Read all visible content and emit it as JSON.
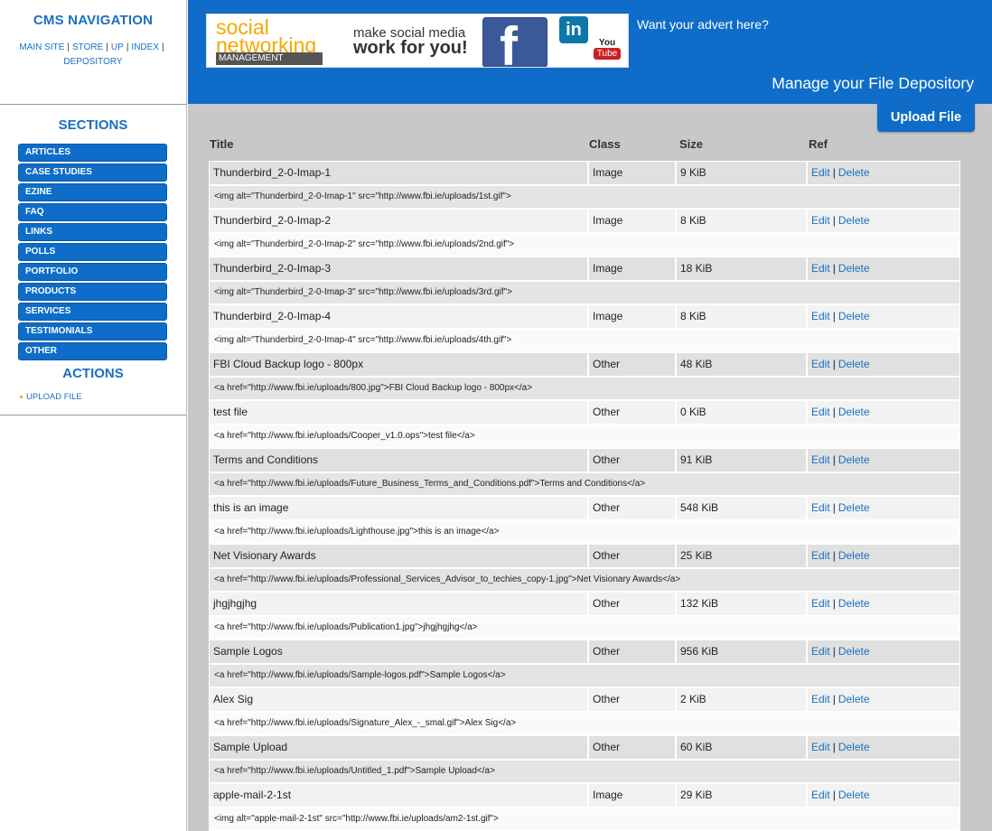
{
  "nav": {
    "title": "CMS NAVIGATION",
    "links": [
      "MAIN SITE",
      "STORE",
      "UP",
      "INDEX",
      "DEPOSITORY"
    ]
  },
  "sections": {
    "title": "SECTIONS",
    "items": [
      "ARTICLES",
      "CASE STUDIES",
      "EZINE",
      "FAQ",
      "LINKS",
      "POLLS",
      "PORTFOLIO",
      "PRODUCTS",
      "SERVICES",
      "TESTIMONIALS",
      "OTHER"
    ]
  },
  "actions": {
    "title": "ACTIONS",
    "items": [
      "UPLOAD FILE"
    ]
  },
  "banner": {
    "social": "social",
    "networking": "networking",
    "management": "MANAGEMENT",
    "make": "make social media",
    "work": "work for you!",
    "fb": "f",
    "li": "in",
    "yt_top": "You",
    "yt_bottom": "Tube"
  },
  "header": {
    "advert": "Want your advert here?",
    "page_title": "Manage your File Depository"
  },
  "upload_button": "Upload File",
  "table": {
    "headers": {
      "title": "Title",
      "class": "Class",
      "size": "Size",
      "ref": "Ref"
    },
    "edit": "Edit",
    "sep": "|",
    "delete": "Delete",
    "rows": [
      {
        "title": "Thunderbird_2-0-Imap-1",
        "class": "Image",
        "size": "9 KiB",
        "code": "<img alt=\"Thunderbird_2-0-Imap-1\" src=\"http://www.fbi.ie/uploads/1st.gif\">"
      },
      {
        "title": "Thunderbird_2-0-Imap-2",
        "class": "Image",
        "size": "8 KiB",
        "code": "<img alt=\"Thunderbird_2-0-Imap-2\" src=\"http://www.fbi.ie/uploads/2nd.gif\">"
      },
      {
        "title": "Thunderbird_2-0-Imap-3",
        "class": "Image",
        "size": "18 KiB",
        "code": "<img alt=\"Thunderbird_2-0-Imap-3\" src=\"http://www.fbi.ie/uploads/3rd.gif\">"
      },
      {
        "title": "Thunderbird_2-0-Imap-4",
        "class": "Image",
        "size": "8 KiB",
        "code": "<img alt=\"Thunderbird_2-0-Imap-4\" src=\"http://www.fbi.ie/uploads/4th.gif\">"
      },
      {
        "title": "FBI Cloud Backup logo - 800px",
        "class": "Other",
        "size": "48 KiB",
        "code": "<a href=\"http://www.fbi.ie/uploads/800.jpg\">FBI Cloud Backup logo - 800px</a>"
      },
      {
        "title": "test file",
        "class": "Other",
        "size": "0 KiB",
        "code": "<a href=\"http://www.fbi.ie/uploads/Cooper_v1.0.ops\">test file</a>"
      },
      {
        "title": "Terms and Conditions",
        "class": "Other",
        "size": "91 KiB",
        "code": "<a href=\"http://www.fbi.ie/uploads/Future_Business_Terms_and_Conditions.pdf\">Terms and Conditions</a>"
      },
      {
        "title": "this is an image",
        "class": "Other",
        "size": "548 KiB",
        "code": "<a href=\"http://www.fbi.ie/uploads/Lighthouse.jpg\">this is an image</a>"
      },
      {
        "title": "Net Visionary Awards",
        "class": "Other",
        "size": "25 KiB",
        "code": "<a href=\"http://www.fbi.ie/uploads/Professional_Services_Advisor_to_techies_copy-1.jpg\">Net Visionary Awards</a>"
      },
      {
        "title": "jhgjhgjhg",
        "class": "Other",
        "size": "132 KiB",
        "code": "<a href=\"http://www.fbi.ie/uploads/Publication1.jpg\">jhgjhgjhg</a>"
      },
      {
        "title": "Sample Logos",
        "class": "Other",
        "size": "956 KiB",
        "code": "<a href=\"http://www.fbi.ie/uploads/Sample-logos.pdf\">Sample Logos</a>"
      },
      {
        "title": "Alex Sig",
        "class": "Other",
        "size": "2 KiB",
        "code": "<a href=\"http://www.fbi.ie/uploads/Signature_Alex_-_smal.gif\">Alex Sig</a>"
      },
      {
        "title": "Sample Upload",
        "class": "Other",
        "size": "60 KiB",
        "code": "<a href=\"http://www.fbi.ie/uploads/Untitled_1.pdf\">Sample Upload</a>"
      },
      {
        "title": "apple-mail-2-1st",
        "class": "Image",
        "size": "29 KiB",
        "code": "<img alt=\"apple-mail-2-1st\" src=\"http://www.fbi.ie/uploads/am2-1st.gif\">"
      }
    ]
  }
}
